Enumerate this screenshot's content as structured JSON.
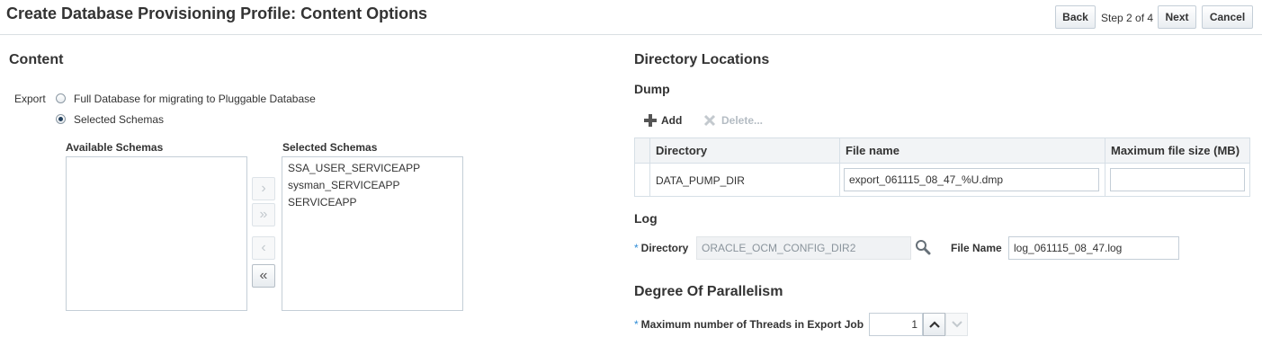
{
  "header": {
    "title": "Create Database Provisioning Profile: Content Options",
    "back_label": "Back",
    "step_label": "Step 2 of 4",
    "next_label": "Next",
    "cancel_label": "Cancel"
  },
  "content": {
    "heading": "Content",
    "export_label": "Export",
    "export_options": [
      {
        "label": "Full Database for migrating to Pluggable Database",
        "selected": false
      },
      {
        "label": "Selected Schemas",
        "selected": true
      }
    ],
    "available_schemas": {
      "label": "Available Schemas",
      "items": []
    },
    "selected_schemas": {
      "label": "Selected Schemas",
      "items": [
        "SSA_USER_SERVICEAPP",
        "sysman_SERVICEAPP",
        "SERVICEAPP"
      ]
    },
    "shuttle": {
      "move": "›",
      "move_all": "»",
      "remove": "‹",
      "remove_all": "«"
    }
  },
  "directory": {
    "heading": "Directory Locations",
    "dump": {
      "heading": "Dump",
      "add_label": "Add",
      "delete_label": "Delete...",
      "columns": [
        "Directory",
        "File name",
        "Maximum file size (MB)"
      ],
      "rows": [
        {
          "directory": "DATA_PUMP_DIR",
          "file_name": "export_061115_08_47_%U.dmp",
          "max_size": ""
        }
      ]
    },
    "log": {
      "heading": "Log",
      "directory_label": "Directory",
      "directory_value": "ORACLE_OCM_CONFIG_DIR2",
      "file_name_label": "File Name",
      "file_name_value": "log_061115_08_47.log"
    },
    "parallelism": {
      "heading": "Degree Of Parallelism",
      "threads_label": "Maximum number of Threads in Export Job",
      "threads_value": "1"
    }
  },
  "required_marker": "*",
  "colors": {
    "accent": "#2e8cd6",
    "border": "#c4ced7",
    "header_bg": "#f2f4f6"
  }
}
